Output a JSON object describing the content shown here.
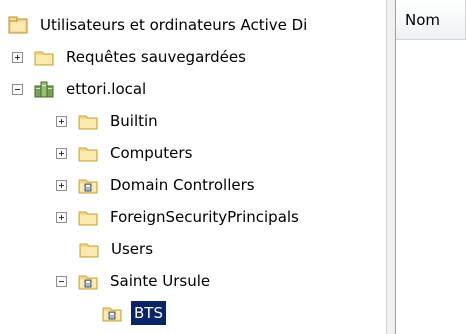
{
  "tree": {
    "root_label": "Utilisateurs et ordinateurs Active Di",
    "nodes": [
      {
        "label": "Requêtes sauvegardées",
        "expander": "plus",
        "icon": "folder-icon"
      },
      {
        "label": "ettori.local",
        "expander": "minus",
        "icon": "domain-icon"
      },
      {
        "label": "Builtin",
        "expander": "plus",
        "icon": "folder-icon"
      },
      {
        "label": "Computers",
        "expander": "plus",
        "icon": "folder-icon"
      },
      {
        "label": "Domain Controllers",
        "expander": "plus",
        "icon": "ou-icon"
      },
      {
        "label": "ForeignSecurityPrincipals",
        "expander": "plus",
        "icon": "folder-icon"
      },
      {
        "label": "Users",
        "expander": "none",
        "icon": "folder-icon"
      },
      {
        "label": "Sainte Ursule",
        "expander": "minus",
        "icon": "ou-icon"
      },
      {
        "label": "BTS",
        "expander": "none",
        "icon": "ou-icon",
        "selected": true
      }
    ]
  },
  "list": {
    "column_header": "Nom"
  },
  "colors": {
    "selection": "#0a246a",
    "folder": "#f4d77e"
  }
}
